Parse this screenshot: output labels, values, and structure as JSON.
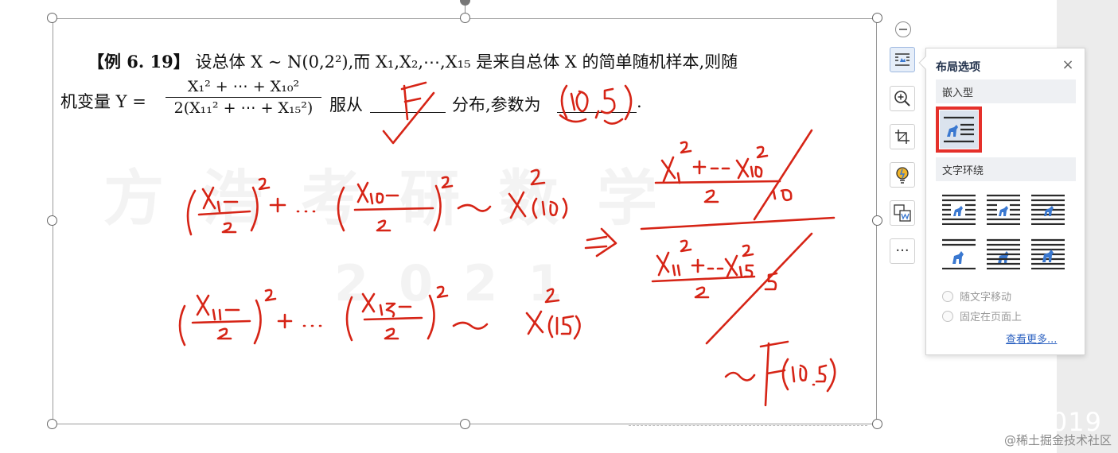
{
  "problem": {
    "label": "【例 6. 19】",
    "text1": "设总体 X ∼ N(0,2²),而 X₁,X₂,⋯,X₁₅ 是来自总体 X 的简单随机样本,则随",
    "text2_prefix": "机变量 Y =",
    "fraction_numerator": "X₁² + ⋯ + X₁₀²",
    "fraction_denominator": "2(X₁₁² + ⋯ + X₁₅²)",
    "text2_mid": "服从",
    "text2_suffix": "分布,参数为",
    "period": "."
  },
  "watermark": {
    "brand": "方浩考研数学",
    "year": "2021"
  },
  "handwriting": {
    "answer_letter": "F",
    "answer_params": "(10, 5)",
    "line1": "(X₁−0 / 2)² + ⋯ (X₁₀−0 / 2)² ∼ χ²(10)",
    "line2": "(X₁₁−0 / 2)² + ⋯ (X₁₅−0 / 2)² ∼ χ²(15)",
    "implies": "⇒",
    "frac_top": "X₁² + ⋯ X₁₀² / 2 / 10",
    "frac_bottom": "X₁₁² + ⋯ X₁₅² / 2 / 5",
    "result": "∼ F(10.5)"
  },
  "toolbar": {
    "items": [
      "collapse",
      "layout-options",
      "zoom-in",
      "crop",
      "smart-lightbulb",
      "image-to-text",
      "more"
    ],
    "more_label": "···"
  },
  "layout_panel": {
    "title": "布局选项",
    "close_label": "×",
    "section_inline": "嵌入型",
    "section_wrap": "文字环绕",
    "radio_move": "随文字移动",
    "radio_fixed": "固定在页面上",
    "see_more": "查看更多..."
  },
  "page_watermark": {
    "year": "2019",
    "site": "@稀土掘金技术社区"
  },
  "colors": {
    "ink_red": "#d62416",
    "highlight_red": "#e5302a",
    "link_blue": "#2f64c2",
    "icon_blue": "#3a78d0"
  }
}
